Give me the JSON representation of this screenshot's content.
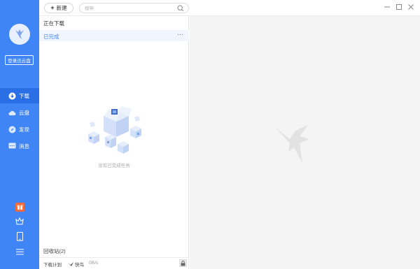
{
  "sidebar": {
    "login_label": "登录迅云盘",
    "nav": [
      {
        "label": "下载",
        "icon": "download-icon",
        "active": true
      },
      {
        "label": "云盘",
        "icon": "cloud-icon",
        "active": false
      },
      {
        "label": "发现",
        "icon": "compass-icon",
        "active": false
      },
      {
        "label": "消息",
        "icon": "message-icon",
        "active": false
      }
    ],
    "bottom_icons": [
      "gift-icon",
      "crown-icon",
      "phone-icon",
      "menu-icon"
    ]
  },
  "toolbar": {
    "new_label": "新建",
    "search_placeholder": "搜神"
  },
  "panel": {
    "downloading_label": "正在下载",
    "completed_label": "已完成",
    "more_label": "···",
    "empty_text": "没有已完成任务",
    "recycle_label": "回收站(2)",
    "plan_label": "下载计划",
    "fast_label": "快鸟",
    "speed_label": "0B/s"
  },
  "colors": {
    "accent": "#3f85f5",
    "sidebar": "#3f85f5",
    "sidebar_active": "#2b6fe6",
    "right_bg": "#f4f4f4"
  }
}
